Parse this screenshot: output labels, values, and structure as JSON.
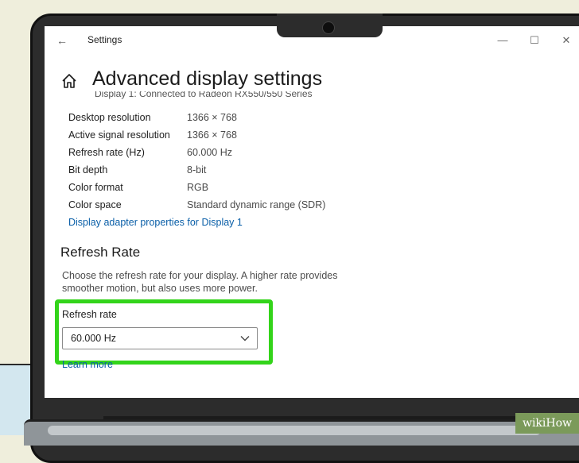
{
  "window": {
    "app_title": "Settings",
    "back_icon": "back-arrow-icon",
    "controls": [
      "minimize-icon",
      "maximize-icon",
      "close-icon"
    ]
  },
  "header": {
    "home_icon": "home-icon",
    "title": "Advanced display settings",
    "cut_line": "Display 1: Connected to Radeon RX550/550 Series"
  },
  "display_info": [
    {
      "label": "Desktop resolution",
      "value": "1366 × 768"
    },
    {
      "label": "Active signal resolution",
      "value": "1366 × 768"
    },
    {
      "label": "Refresh rate (Hz)",
      "value": "60.000 Hz"
    },
    {
      "label": "Bit depth",
      "value": "8-bit"
    },
    {
      "label": "Color format",
      "value": "RGB"
    },
    {
      "label": "Color space",
      "value": "Standard dynamic range (SDR)"
    }
  ],
  "adapter_link": "Display adapter properties for Display 1",
  "refresh_section": {
    "title": "Refresh Rate",
    "description": "Choose the refresh rate for your display. A higher rate provides smoother motion, but also uses more power.",
    "dropdown_label": "Refresh rate",
    "dropdown_value": "60.000 Hz",
    "learn_more": "Learn more"
  },
  "colors": {
    "highlight": "#33d41a",
    "link": "#0a5fa8"
  },
  "watermark": "wikiHow"
}
